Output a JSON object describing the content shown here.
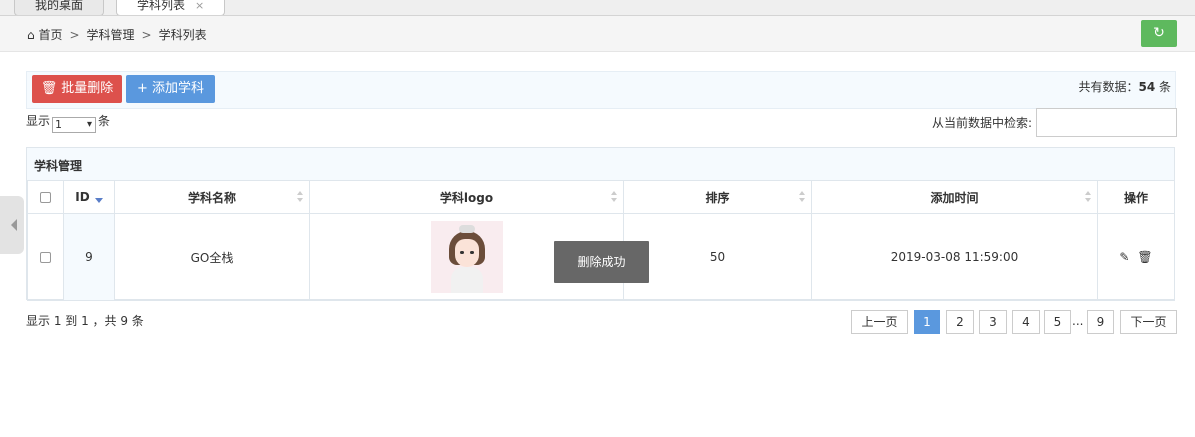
{
  "tabs": [
    {
      "label": "我的桌面",
      "active": false
    },
    {
      "label": "学科列表",
      "active": true,
      "close": "×"
    }
  ],
  "breadcrumb": {
    "home_icon": "home-icon",
    "items": [
      "首页",
      "学科管理",
      "学科列表"
    ],
    "separator": ">"
  },
  "refresh": {
    "icon": "refresh-icon",
    "glyph": "↻",
    "color": "#5eb95e"
  },
  "toolbar": {
    "batch_delete": {
      "label": "批量删除",
      "icon": "trash-icon",
      "glyph": "🗑",
      "color": "#dd514c"
    },
    "add_subject": {
      "label": "添加学科",
      "icon": "plus-icon",
      "glyph": "+",
      "color": "#5a98de"
    },
    "total_prefix": "共有数据：",
    "total_count": "54",
    "total_suffix": " 条"
  },
  "length": {
    "prefix": "显示",
    "value": "1",
    "suffix": "条"
  },
  "search": {
    "label": "从当前数据中检索:",
    "value": ""
  },
  "table": {
    "title": "学科管理",
    "columns": [
      "",
      "ID",
      "学科名称",
      "学科logo",
      "排序",
      "添加时间",
      "操作"
    ],
    "rows": [
      {
        "id": "9",
        "name": "GO全栈",
        "logo": "avatar-thumbnail",
        "order": "50",
        "created": "2019-03-08 11:59:00",
        "actions": {
          "edit": "✎",
          "delete": "🗑"
        }
      }
    ]
  },
  "toast": "删除成功",
  "info": "显示 1 到 1 ，共 9 条",
  "pagination": {
    "prev": "上一页",
    "pages": [
      "1",
      "2",
      "3",
      "4",
      "5"
    ],
    "ellipsis": "...",
    "last": "9",
    "next": "下一页",
    "current": "1",
    "active_color": "#5a98de"
  }
}
